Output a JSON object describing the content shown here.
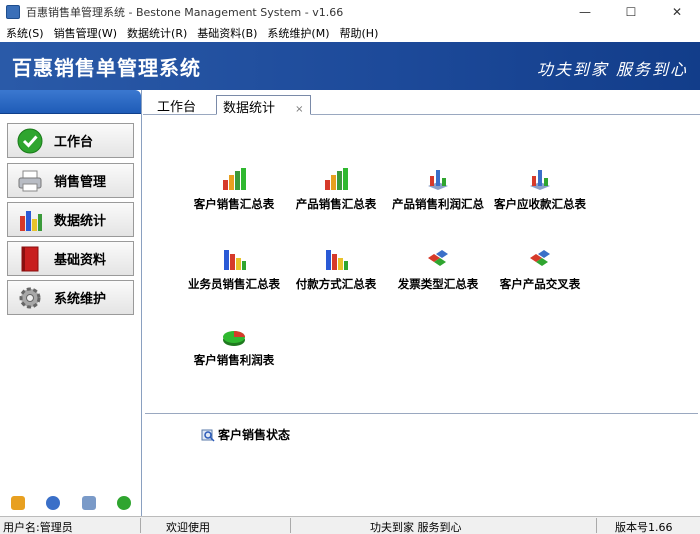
{
  "window": {
    "title": "百惠销售单管理系统 - Bestone Management System - v1.66",
    "controls": [
      "—",
      "☐",
      "✕"
    ]
  },
  "menu": [
    "系统(S)",
    "销售管理(W)",
    "数据统计(R)",
    "基础资料(B)",
    "系统维护(M)",
    "帮助(H)"
  ],
  "banner": {
    "title": "百惠销售单管理系统",
    "slogan": "功夫到家  服务到心"
  },
  "sidebar": {
    "items": [
      {
        "label": "工作台",
        "icon": "green-check-icon"
      },
      {
        "label": "销售管理",
        "icon": "printer-icon"
      },
      {
        "label": "数据统计",
        "icon": "bar-chart-icon"
      },
      {
        "label": "基础资料",
        "icon": "red-book-icon"
      },
      {
        "label": "系统维护",
        "icon": "gear-icon"
      }
    ],
    "tools": [
      "edit-icon",
      "clock-icon",
      "search-icon",
      "refresh-icon"
    ]
  },
  "tabs": [
    {
      "label": "工作台",
      "active": false
    },
    {
      "label": "数据统计",
      "active": true,
      "close": "×"
    }
  ],
  "reports": [
    {
      "label": "客户销售汇总表",
      "icon": "bar-chart-icon"
    },
    {
      "label": "产品销售汇总表",
      "icon": "bar-chart-icon"
    },
    {
      "label": "产品销售利润汇总",
      "icon": "3d-bar-chart-icon"
    },
    {
      "label": "客户应收款汇总表",
      "icon": "3d-bar-chart-icon"
    },
    {
      "label": "业务员销售汇总表",
      "icon": "column-chart-icon"
    },
    {
      "label": "付款方式汇总表",
      "icon": "column-chart-icon"
    },
    {
      "label": "发票类型汇总表",
      "icon": "cubes-icon"
    },
    {
      "label": "客户产品交叉表",
      "icon": "cubes-icon"
    },
    {
      "label": "客户销售利润表",
      "icon": "pie-chart-icon"
    }
  ],
  "bottom_panel": {
    "link": "客户销售状态",
    "icon": "search-report-icon"
  },
  "statusbar": {
    "user": "用户名:管理员",
    "welcome": "欢迎使用",
    "slogan": "功夫到家 服务到心",
    "version": "版本号1.66"
  },
  "colors": {
    "banner": "#1d4a9a",
    "sidebar_header": "#2a66c4",
    "accent_green": "#2fa52f"
  }
}
